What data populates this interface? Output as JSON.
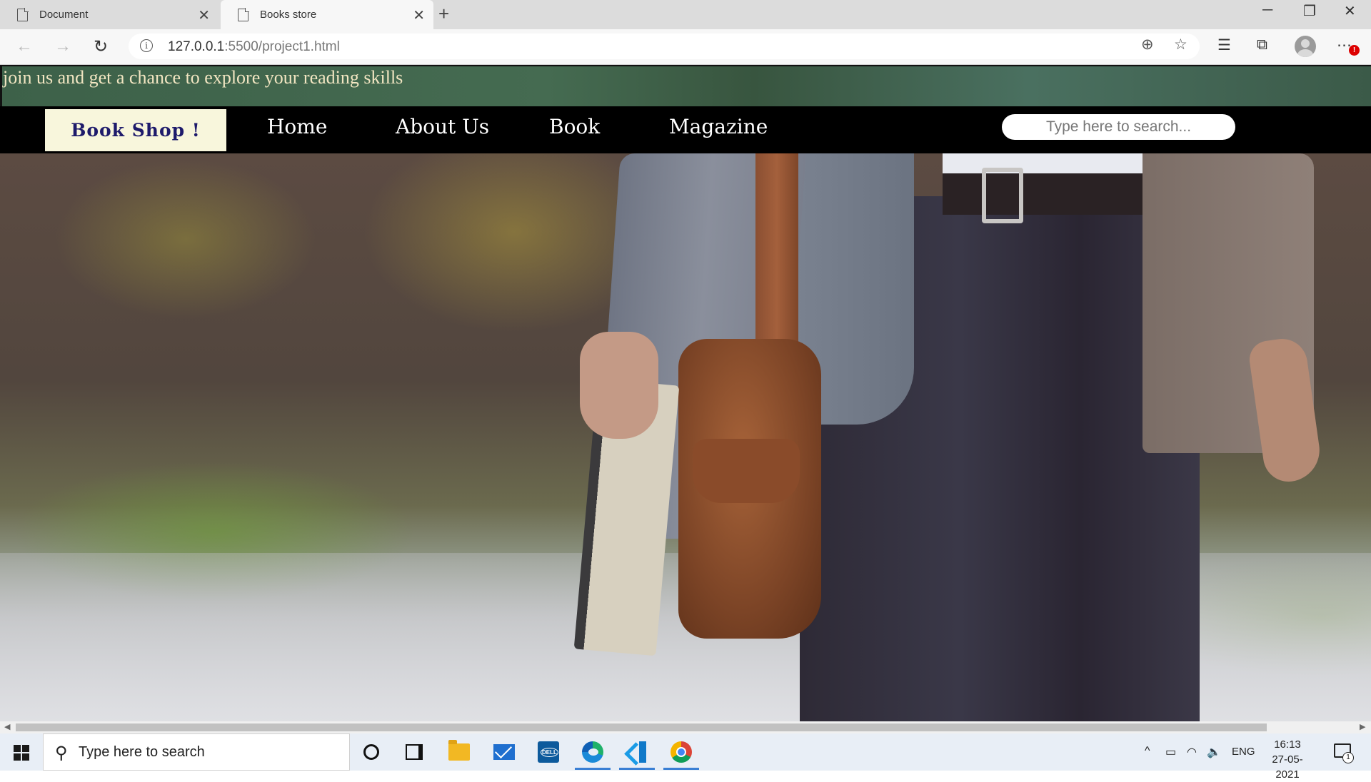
{
  "browser": {
    "tabs": [
      {
        "title": "Document",
        "active": false
      },
      {
        "title": "Books store",
        "active": true
      }
    ],
    "url_host": "127.0.0.1",
    "url_rest": ":5500/project1.html"
  },
  "page": {
    "tagline": "join us and get a chance to explore your reading skills",
    "brand": "Book Shop !",
    "nav": [
      {
        "label": "Home"
      },
      {
        "label": "About Us"
      },
      {
        "label": "Book"
      },
      {
        "label": "Magazine"
      }
    ],
    "search_placeholder": "Type here to search..."
  },
  "taskbar": {
    "search_text": "Type here to search",
    "lang": "ENG",
    "time": "16:13",
    "date": "27-05-2021",
    "notification_count": "1"
  },
  "icons": {
    "accent": "#3a7fd4",
    "brand_bg": "#f8f6dc",
    "brand_text": "#1e1a6b",
    "tagline_color": "#f2e6c2"
  }
}
